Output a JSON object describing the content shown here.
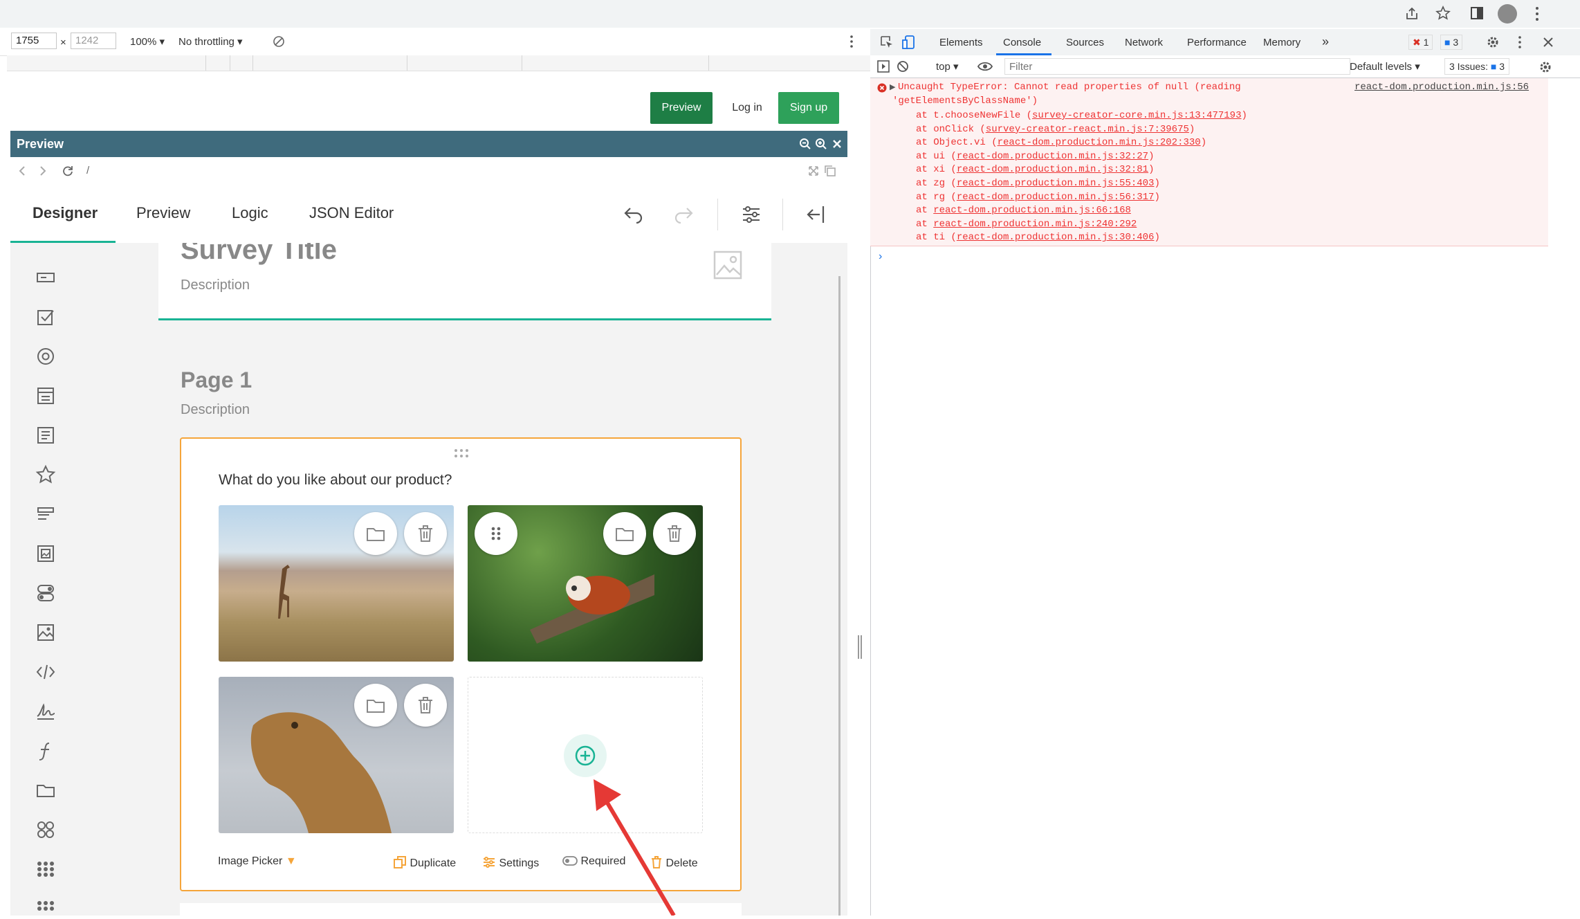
{
  "browser": {
    "viewport_width": "1755",
    "viewport_height": "1242",
    "zoom": "100%",
    "throttling": "No throttling"
  },
  "site": {
    "preview_label": "Preview",
    "login_label": "Log in",
    "signup_label": "Sign up"
  },
  "preview_frame": {
    "title": "Preview",
    "path": "/"
  },
  "creator": {
    "tabs": [
      "Designer",
      "Preview",
      "Logic",
      "JSON Editor"
    ],
    "survey_title": "Survey Title",
    "survey_description": "Description",
    "page_title": "Page 1",
    "page_description": "Description",
    "question_title": "What do you like about our product?",
    "question_type": "Image Picker",
    "actions": {
      "duplicate": "Duplicate",
      "settings": "Settings",
      "required": "Required",
      "delete": "Delete"
    },
    "accent": "#19b394",
    "selection_color": "#f5a53a"
  },
  "devtools": {
    "tabs": [
      "Elements",
      "Console",
      "Sources",
      "Network",
      "Performance",
      "Memory"
    ],
    "error_count": "1",
    "message_count": "3",
    "context": "top",
    "filter_placeholder": "Filter",
    "levels": "Default levels",
    "issues_label": "3 Issues:",
    "issues_count": "3",
    "error_message_1": "Uncaught TypeError: Cannot read properties of null (reading",
    "error_message_2": "'getElementsByClassName')",
    "error_source": "react-dom.production.min.js:56",
    "stack": [
      {
        "fn": "at t.chooseNewFile (",
        "file": "survey-creator-core.min.js:13:477193",
        "end": ")"
      },
      {
        "fn": "at onClick (",
        "file": "survey-creator-react.min.js:7:39675",
        "end": ")"
      },
      {
        "fn": "at Object.vi (",
        "file": "react-dom.production.min.js:202:330",
        "end": ")"
      },
      {
        "fn": "at ui (",
        "file": "react-dom.production.min.js:32:27",
        "end": ")"
      },
      {
        "fn": "at xi (",
        "file": "react-dom.production.min.js:32:81",
        "end": ")"
      },
      {
        "fn": "at zg (",
        "file": "react-dom.production.min.js:55:403",
        "end": ")"
      },
      {
        "fn": "at rg (",
        "file": "react-dom.production.min.js:56:317",
        "end": ")"
      },
      {
        "fn": "at ",
        "file": "react-dom.production.min.js:66:168",
        "end": ""
      },
      {
        "fn": "at ",
        "file": "react-dom.production.min.js:240:292",
        "end": ""
      },
      {
        "fn": "at ti (",
        "file": "react-dom.production.min.js:30:406",
        "end": ")"
      }
    ],
    "error_color": "#e33"
  }
}
